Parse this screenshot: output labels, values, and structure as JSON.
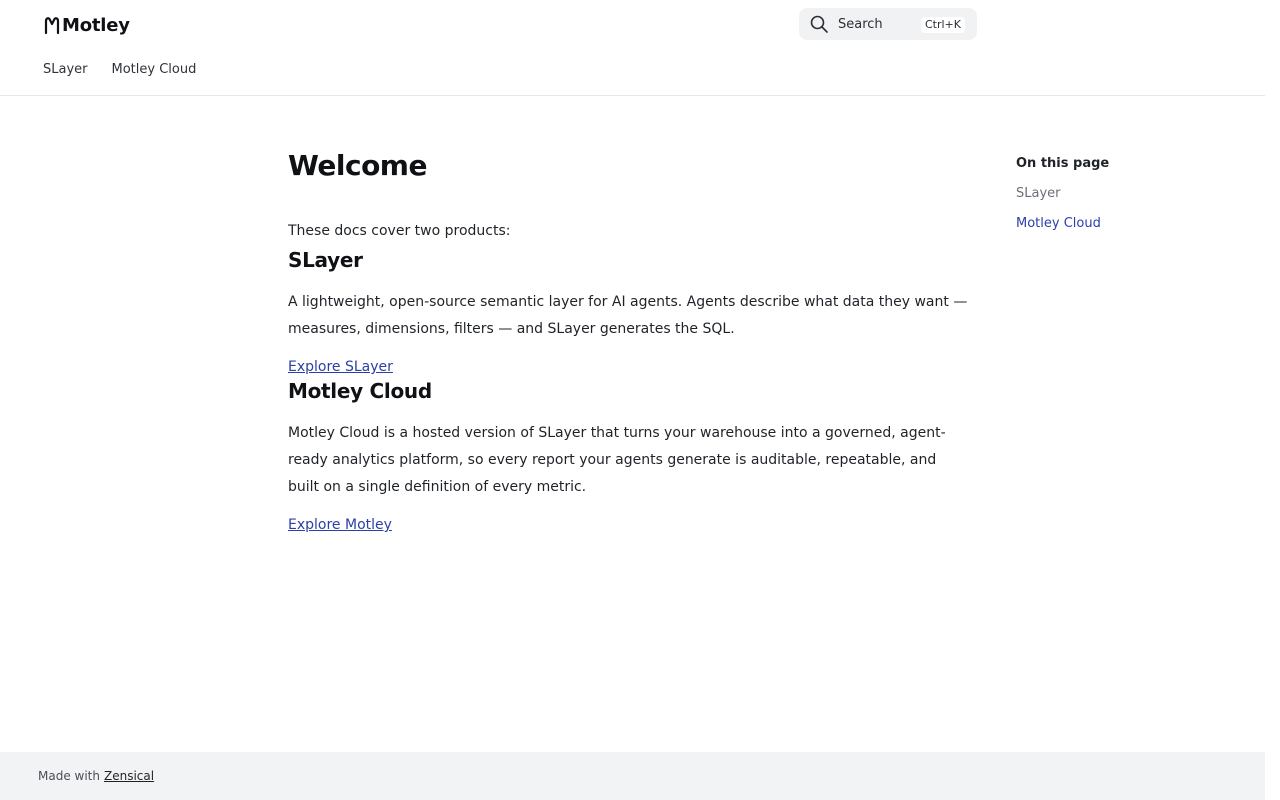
{
  "header": {
    "logo_text": "Motley",
    "search": {
      "label": "Search",
      "shortcut": "Ctrl+K"
    },
    "tabs": [
      {
        "label": "SLayer"
      },
      {
        "label": "Motley Cloud"
      }
    ]
  },
  "main": {
    "title": "Welcome",
    "intro": "These docs cover two products:",
    "sections": [
      {
        "heading": "SLayer",
        "body": "A lightweight, open-source semantic layer for AI agents. Agents describe what data they want — measures, dimensions, filters — and SLayer generates the SQL.",
        "link": "Explore SLayer"
      },
      {
        "heading": "Motley Cloud",
        "body": "Motley Cloud is a hosted version of SLayer that turns your warehouse into a governed, agent-ready analytics platform, so every report your agents generate is auditable, repeatable, and built on a single definition of every metric.",
        "link": "Explore Motley"
      }
    ]
  },
  "toc": {
    "title": "On this page",
    "items": [
      {
        "label": "SLayer",
        "active": false
      },
      {
        "label": "Motley Cloud",
        "active": true
      }
    ]
  },
  "footer": {
    "prefix": "Made with",
    "link": "Zensical"
  },
  "colors": {
    "link": "#2b3fa8",
    "toc_active": "#2b3fa8",
    "footer_bg": "#f2f3f5",
    "search_bg": "#f1f2f4"
  }
}
